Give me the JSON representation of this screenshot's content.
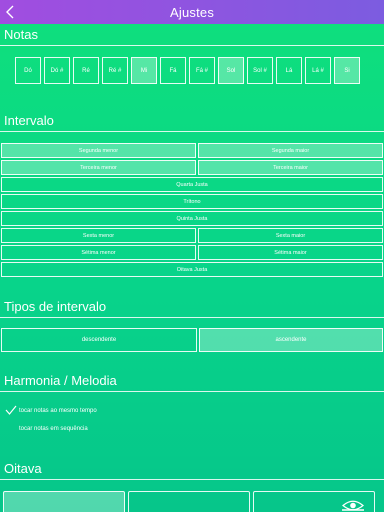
{
  "header": {
    "title": "Ajustes"
  },
  "sections": {
    "notes": "Notas",
    "interval": "Intervalo",
    "interval_types": "Tipos de intervalo",
    "harmony": "Harmonia / Melodia",
    "octave": "Oitava"
  },
  "notes": [
    {
      "label": "Dó",
      "selected": false
    },
    {
      "label": "Dó #",
      "selected": false
    },
    {
      "label": "Ré",
      "selected": false
    },
    {
      "label": "Ré #",
      "selected": false
    },
    {
      "label": "Mi",
      "selected": true
    },
    {
      "label": "Fá",
      "selected": false
    },
    {
      "label": "Fá #",
      "selected": false
    },
    {
      "label": "Sol",
      "selected": true
    },
    {
      "label": "Sol #",
      "selected": false
    },
    {
      "label": "Lá",
      "selected": false
    },
    {
      "label": "Lá #",
      "selected": false
    },
    {
      "label": "Si",
      "selected": true
    }
  ],
  "intervals": {
    "segunda_menor": "Segunda menor",
    "segunda_maior": "Segunda maior",
    "terceira_menor": "Terceira menor",
    "terceira_maior": "Terceira maior",
    "quarta_justa": "Quarta Justa",
    "tritono": "Trítono",
    "quinta_justa": "Quinta Justa",
    "sexta_menor": "Sexta menor",
    "sexta_maior": "Sexta maior",
    "setima_menor": "Sétima menor",
    "setima_maior": "Sétima maior",
    "oitava_justa": "Oitava Justa"
  },
  "interval_types": {
    "descending": "descendente",
    "ascending": "ascendente"
  },
  "harmony": {
    "together": "tocar notas ao mesmo tempo",
    "sequence": "tocar notas em sequência",
    "selected": "together"
  },
  "icons": {
    "back": "chevron-left-icon",
    "check": "checkmark-icon",
    "octave": "eye-icon"
  },
  "colors": {
    "title_bar_start": "#a14de0",
    "title_bar_end": "#7c5ce0",
    "background_top": "#0fe07c",
    "background_bottom": "#06c68a"
  }
}
